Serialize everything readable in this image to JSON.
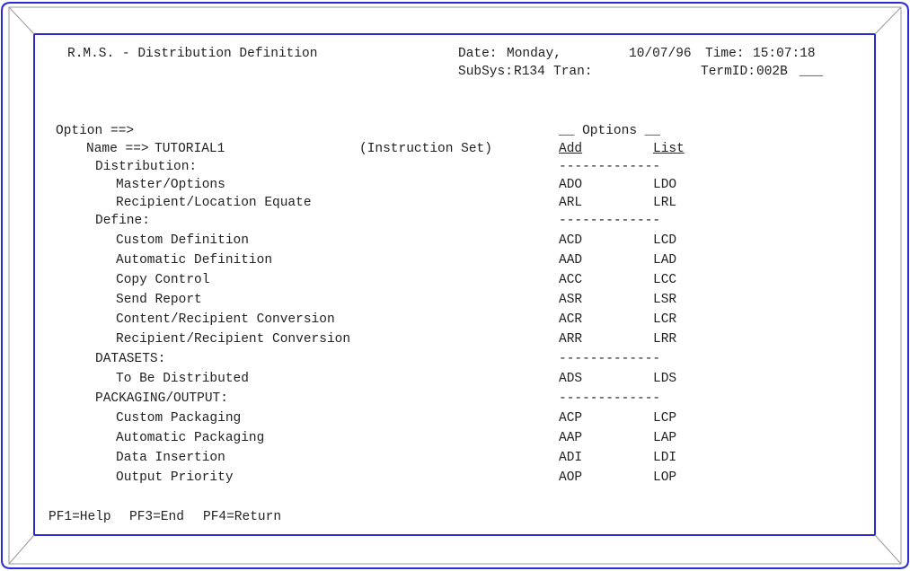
{
  "header": {
    "title": "R.M.S. - Distribution Definition",
    "date_label": "Date:",
    "date_value": "Monday,",
    "date_numeric": "10/07/96",
    "time_label": "Time:",
    "time_value": "15:07:18",
    "subsys_label": "SubSys:",
    "subsys_value": "R134",
    "tran_label": "Tran:",
    "termid_label": "TermID:",
    "termid_value": "002B",
    "termid_field": "___"
  },
  "form": {
    "option_label": "Option ==>",
    "name_label": "Name ==>",
    "name_value": "TUTORIAL1",
    "name_note": "(Instruction Set)",
    "options_header": "__ Options __",
    "col_add": "Add",
    "col_list": "List"
  },
  "groups": [
    {
      "label": "Distribution:",
      "rule": "-------------",
      "items": [
        {
          "label": "Master/Options",
          "add": "ADO",
          "list": "LDO"
        },
        {
          "label": "Recipient/Location Equate",
          "add": "ARL",
          "list": "LRL"
        }
      ]
    },
    {
      "label": "Define:",
      "rule": "-------------",
      "items": [
        {
          "label": "Custom Definition",
          "add": "ACD",
          "list": "LCD"
        },
        {
          "label": "Automatic Definition",
          "add": "AAD",
          "list": "LAD"
        },
        {
          "label": "Copy Control",
          "add": "ACC",
          "list": "LCC"
        },
        {
          "label": "Send Report",
          "add": "ASR",
          "list": "LSR"
        },
        {
          "label": "Content/Recipient Conversion",
          "add": "ACR",
          "list": "LCR"
        },
        {
          "label": "Recipient/Recipient Conversion",
          "add": "ARR",
          "list": "LRR"
        }
      ]
    },
    {
      "label": "DATASETS:",
      "rule": "-------------",
      "items": [
        {
          "label": "To Be Distributed",
          "add": "ADS",
          "list": "LDS"
        }
      ]
    },
    {
      "label": "PACKAGING/OUTPUT:",
      "rule": "-------------",
      "items": [
        {
          "label": "Custom Packaging",
          "add": "ACP",
          "list": "LCP"
        },
        {
          "label": "Automatic Packaging",
          "add": "AAP",
          "list": "LAP"
        },
        {
          "label": "Data Insertion",
          "add": "ADI",
          "list": "LDI"
        },
        {
          "label": "Output Priority",
          "add": "AOP",
          "list": "LOP"
        }
      ]
    }
  ],
  "footer": {
    "pf1": "PF1=Help",
    "pf3": "PF3=End",
    "pf4": "PF4=Return"
  },
  "colors": {
    "frame": "#2b2bd6",
    "text": "#222222"
  }
}
